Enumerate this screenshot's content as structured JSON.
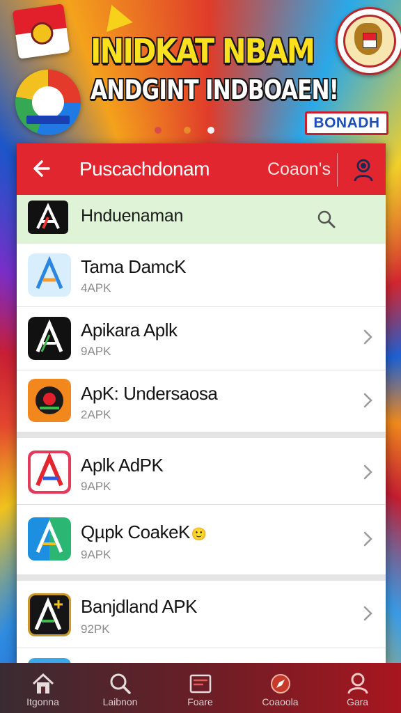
{
  "banner": {
    "headline": "INIDKAT NBAM",
    "subheadline": "ANDGINT INDBOAEN!",
    "badge": "BONADH",
    "page_dots": 3,
    "active_dot": 3,
    "colors": {
      "headline": "#fbe11d",
      "dot_1": "#d94a4a",
      "dot_2": "#e98a2a",
      "dot_3": "#f2f2f2"
    }
  },
  "appbar": {
    "back_icon": "arrow-left-icon",
    "title": "Puscachdonam",
    "action": "Coaon's",
    "account_icon": "user-icon",
    "color": "#e2262f"
  },
  "search": {
    "text": "Hnduenaman",
    "icon": "search-icon",
    "background": "#dff3d6"
  },
  "apps": [
    {
      "name": "Tama DamcK",
      "sub": "4APK",
      "chevron": false,
      "icon_style": "light-blue"
    },
    {
      "name": "Apikara Aplk",
      "sub": "9APK",
      "chevron": true,
      "icon_style": "dark"
    },
    {
      "name": "ApK: Undersaosa",
      "sub": "2APK",
      "chevron": true,
      "icon_style": "orange-emblem"
    },
    {
      "name": "Aplk AdPK",
      "sub": "9APK",
      "chevron": true,
      "icon_style": "red-blue"
    },
    {
      "name": "Qµpk CoakeK",
      "sub": "9APK",
      "chevron": true,
      "icon_style": "blue-green",
      "emoji": "🙂"
    },
    {
      "name": "Banjdland APK",
      "sub": "92PK",
      "chevron": true,
      "icon_style": "black-yellow"
    }
  ],
  "tabbar": {
    "tabs": [
      {
        "label": "Itgonna",
        "icon": "home-icon"
      },
      {
        "label": "Laibnon",
        "icon": "search-icon"
      },
      {
        "label": "Foare",
        "icon": "folder-icon"
      },
      {
        "label": "Coaoola",
        "icon": "compass-icon"
      },
      {
        "label": "Gara",
        "icon": "profile-icon"
      }
    ]
  }
}
